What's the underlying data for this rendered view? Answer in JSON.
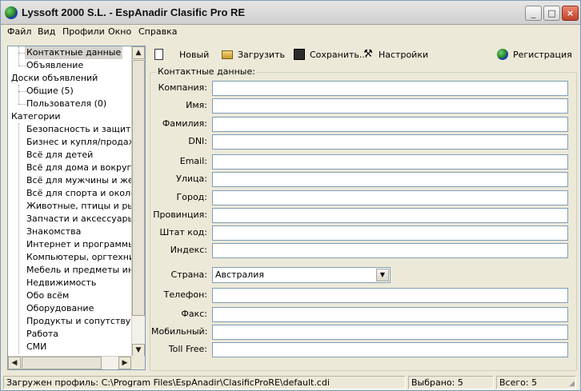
{
  "window": {
    "title": "Lyssoft 2000 S.L. - EspAnadir Clasific Pro RE"
  },
  "menu": [
    "Файл",
    "Вид",
    "Профили",
    "Окно",
    "Справка"
  ],
  "tree": {
    "items": [
      {
        "label": "Контактные данные",
        "selected": true
      },
      {
        "label": "Объявление"
      },
      {
        "label": "Доски объявлений"
      },
      {
        "label": "Общие (5)"
      },
      {
        "label": "Пользователя (0)"
      },
      {
        "label": "Категории"
      },
      {
        "label": "Безопасность и защита"
      },
      {
        "label": "Бизнес и купля/продажа"
      },
      {
        "label": "Всё для детей"
      },
      {
        "label": "Всё для дома и вокруг не"
      },
      {
        "label": "Всё для мужчины и женщ"
      },
      {
        "label": "Всё для спорта и около не"
      },
      {
        "label": "Животные, птицы и рыбы"
      },
      {
        "label": "Запчасти и аксессуары д."
      },
      {
        "label": "Знакомства"
      },
      {
        "label": "Интернет и программы"
      },
      {
        "label": "Компьютеры, оргтехника"
      },
      {
        "label": "Мебель и предметы интер"
      },
      {
        "label": "Недвижимость"
      },
      {
        "label": "Обо всём"
      },
      {
        "label": "Оборудование"
      },
      {
        "label": "Продукты и сопутствующ"
      },
      {
        "label": "Работа"
      },
      {
        "label": "СМИ"
      }
    ]
  },
  "toolbar": {
    "new": "Новый",
    "load": "Загрузить",
    "save": "Сохранить...",
    "settings": "Настройки",
    "register": "Регистрация"
  },
  "form": {
    "group_title": "Контактные данные:",
    "fields": [
      {
        "label": "Компания:",
        "value": ""
      },
      {
        "label": "Имя:",
        "value": ""
      },
      {
        "label": "Фамилия:",
        "value": ""
      },
      {
        "label": "DNI:",
        "value": ""
      },
      {
        "label": "Email:",
        "value": ""
      },
      {
        "label": "Улица:",
        "value": ""
      },
      {
        "label": "Город:",
        "value": ""
      },
      {
        "label": "Провинция:",
        "value": ""
      },
      {
        "label": "Штат код:",
        "value": ""
      },
      {
        "label": "Индекс:",
        "value": ""
      }
    ],
    "country_label": "Страна:",
    "country_value": "Австралия",
    "fields2": [
      {
        "label": "Телефон:",
        "value": ""
      },
      {
        "label": "Факс:",
        "value": ""
      },
      {
        "label": "Мобильный:",
        "value": ""
      },
      {
        "label": "Toll Free:",
        "value": ""
      }
    ]
  },
  "status": {
    "profile": "Загружен профиль: C:\\Program Files\\EspAnadir\\ClasificProRE\\default.cdi",
    "selected": "Выбрано: 5",
    "total": "Всего: 5"
  }
}
